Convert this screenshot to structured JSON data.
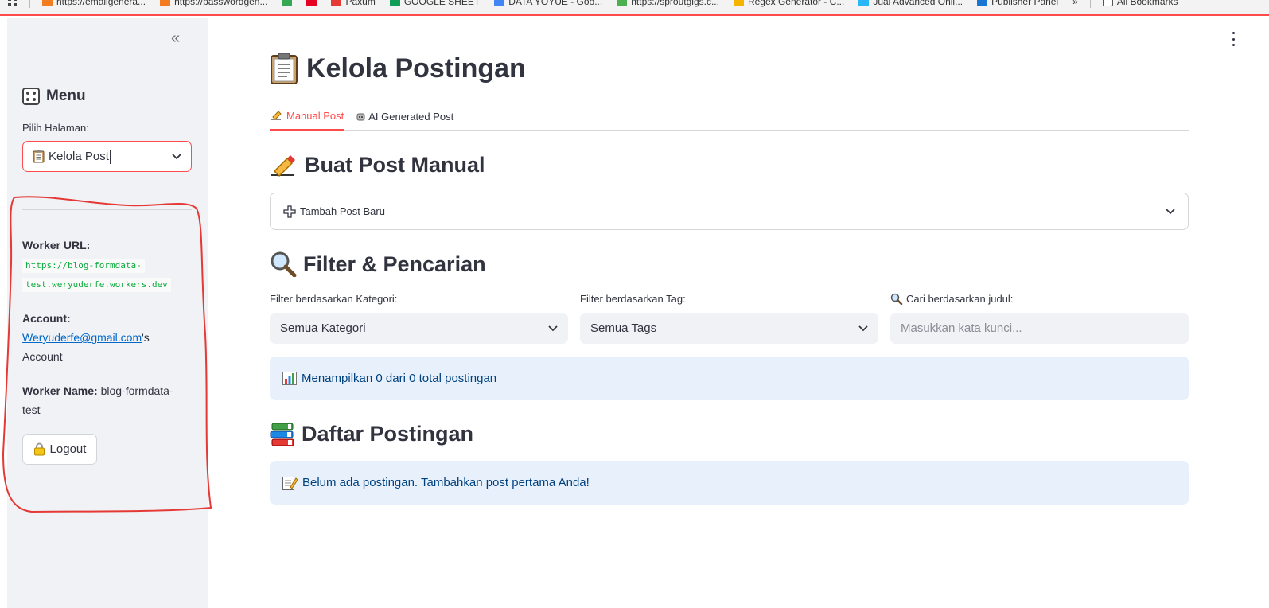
{
  "bookmarks": [
    {
      "label": "https://emailgenera...",
      "color": "#f47c20"
    },
    {
      "label": "https://passwordgen...",
      "color": "#f47c20"
    },
    {
      "label": "",
      "color": "#34a853"
    },
    {
      "label": "",
      "color": "#e60023"
    },
    {
      "label": "Paxum",
      "color": "#e53935"
    },
    {
      "label": "GOOGLE SHEET",
      "color": "#0f9d58"
    },
    {
      "label": "DATA YOYUE - Goo...",
      "color": "#4285f4"
    },
    {
      "label": "https://sproutgigs.c...",
      "color": "#4caf50"
    },
    {
      "label": "Regex Generator - C...",
      "color": "#f4b400"
    },
    {
      "label": "Jual Advanced Onli...",
      "color": "#29b6f6"
    },
    {
      "label": "Publisher Panel",
      "color": "#1976d2"
    }
  ],
  "bookmarks_more": "»",
  "bookmarks_all": "All Bookmarks",
  "sidebar": {
    "collapse_icon": "«",
    "menu_title": "Menu",
    "pick_label": "Pilih Halaman:",
    "selected_page": "Kelola Post",
    "worker_url_label": "Worker URL:",
    "worker_url_value_1": "https://blog-formdata-",
    "worker_url_value_2": "test.weryuderfe.workers.dev",
    "account_label": "Account:",
    "account_email": "Weryuderfe@gmail.com",
    "account_suffix": "'s",
    "account_word": "Account",
    "worker_name_label": "Worker Name:",
    "worker_name_value": "blog-formdata-",
    "worker_name_value_2": "test",
    "logout_label": "Logout"
  },
  "main": {
    "title": "Kelola Postingan",
    "tabs": [
      {
        "label": "Manual Post",
        "icon": "✍",
        "active": true
      },
      {
        "label": "AI Generated Post",
        "icon": "🤖",
        "active": false
      }
    ],
    "manual_heading": "Buat Post Manual",
    "add_post_label": "Tambah Post Baru",
    "filter_heading": "Filter & Pencarian",
    "category_label": "Filter berdasarkan Kategori:",
    "category_value": "Semua Kategori",
    "tag_label": "Filter berdasarkan Tag:",
    "tag_value": "Semua Tags",
    "search_label": "Cari berdasarkan judul:",
    "search_placeholder": "Masukkan kata kunci...",
    "showing_info": "Menampilkan 0 dari 0 total postingan",
    "list_heading": "Daftar Postingan",
    "empty_info": "Belum ada postingan. Tambahkan post pertama Anda!"
  },
  "colors": {
    "accent": "#ff4b4b",
    "info_bg": "#e8f1fb",
    "info_text": "#004280",
    "sidebar_bg": "#f0f2f6",
    "annotation": "#e53935"
  }
}
